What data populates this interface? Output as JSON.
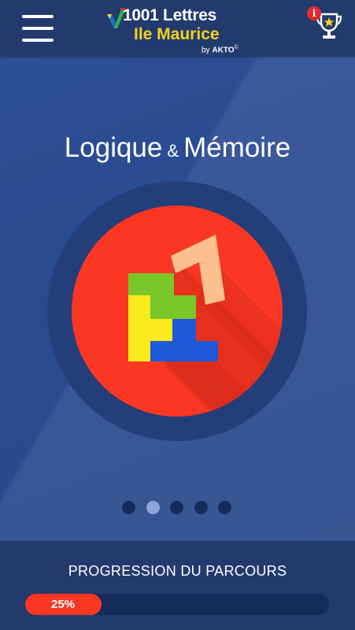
{
  "header": {
    "logo": {
      "line1": "1001 Lettres",
      "line2": "Ile Maurice",
      "by_prefix": "by",
      "by_brand": "AKTO",
      "copyright": "©"
    },
    "menu_icon": "hamburger-menu-icon",
    "trophy_icon": "trophy-star-icon",
    "info_badge": "i"
  },
  "main": {
    "title_part1": "Logique",
    "title_amp": "&",
    "title_part2": "Mémoire",
    "illustration": "block-puzzle-pieces-icon",
    "pager": {
      "count": 5,
      "active_index": 1
    }
  },
  "footer": {
    "progress_label": "PROGRESSION DU PARCOURS",
    "progress_value": 0.25,
    "progress_text": "25%"
  },
  "colors": {
    "background": "#2a4a8f",
    "bar": "#223a6e",
    "accent_red": "#fb3723",
    "logo_yellow": "#f4d21a",
    "dot_inactive": "#152c5a",
    "dot_active": "#8fa6dc"
  }
}
